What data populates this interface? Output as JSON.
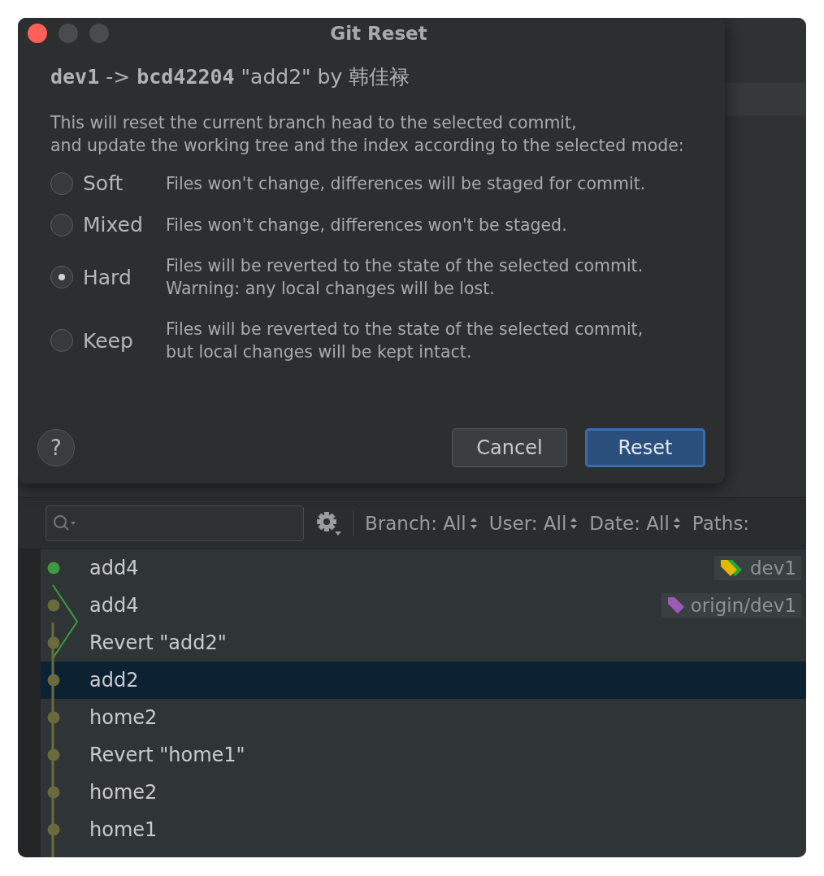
{
  "dialog": {
    "title": "Git Reset",
    "header": {
      "branch": "dev1",
      "arrow": "->",
      "hash": "bcd42204",
      "message": "\"add2\" by 韩佳禄"
    },
    "description": [
      "This will reset the current branch head to the selected commit,",
      "and update the working tree and the index according to the selected mode:"
    ],
    "modes": [
      {
        "label": "Soft",
        "selected": false,
        "description": [
          "Files won't change, differences will be staged for commit."
        ]
      },
      {
        "label": "Mixed",
        "selected": false,
        "description": [
          "Files won't change, differences won't be staged."
        ]
      },
      {
        "label": "Hard",
        "selected": true,
        "description": [
          "Files will be reverted to the state of the selected commit.",
          "Warning: any local changes will be lost."
        ]
      },
      {
        "label": "Keep",
        "selected": false,
        "description": [
          "Files will be reverted to the state of the selected commit,",
          "but local changes will be kept intact."
        ]
      }
    ],
    "help": "?",
    "buttons": [
      {
        "label": "Cancel",
        "kind": "secondary"
      },
      {
        "label": "Reset",
        "kind": "primary"
      }
    ]
  },
  "log": {
    "filters": [
      "Branch: All",
      "User: All",
      "Date: All",
      "Paths:"
    ],
    "commits": [
      {
        "message": "add4",
        "color": "#3f9a3f",
        "selected": false,
        "tag": {
          "label": "dev1",
          "kind": "local"
        }
      },
      {
        "message": "add4",
        "color": "#6a6a3c",
        "selected": false,
        "tag": {
          "label": "origin/dev1",
          "kind": "remote"
        }
      },
      {
        "message": "Revert \"add2\"",
        "color": "#6a6a3c",
        "selected": false
      },
      {
        "message": "add2",
        "color": "#6a6a3c",
        "selected": true
      },
      {
        "message": "home2",
        "color": "#6a6a3c",
        "selected": false
      },
      {
        "message": "Revert \"home1\"",
        "color": "#6a6a3c",
        "selected": false
      },
      {
        "message": "home2",
        "color": "#6a6a3c",
        "selected": false
      },
      {
        "message": "home1",
        "color": "#6a6a3c",
        "selected": false
      }
    ]
  }
}
